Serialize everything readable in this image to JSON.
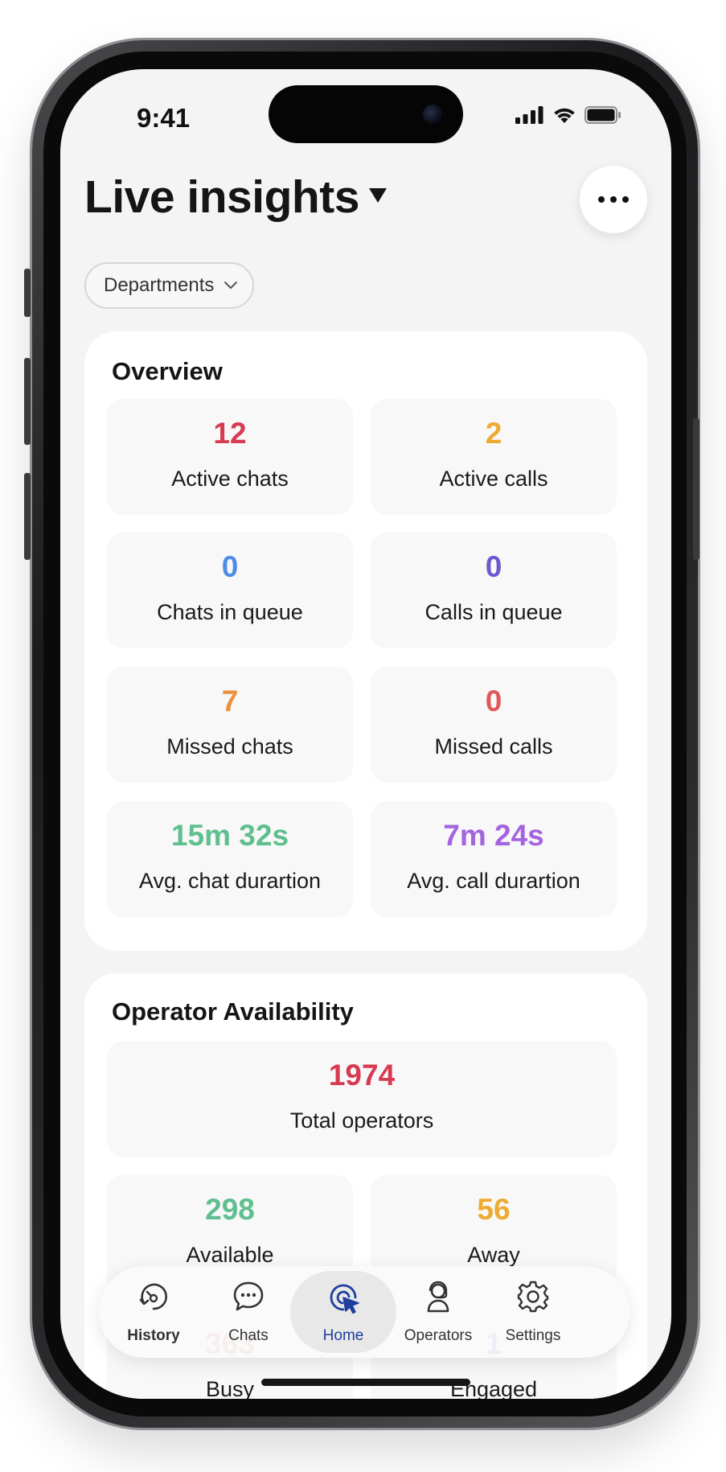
{
  "status_bar": {
    "time": "9:41"
  },
  "header": {
    "title": "Live insights",
    "filter_label": "Departments"
  },
  "overview": {
    "title": "Overview",
    "tiles": [
      {
        "value": "12",
        "label": "Active chats",
        "color": "#d63b52"
      },
      {
        "value": "2",
        "label": "Active calls",
        "color": "#eeaa33"
      },
      {
        "value": "0",
        "label": "Chats in queue",
        "color": "#4f8be8"
      },
      {
        "value": "0",
        "label": "Calls in queue",
        "color": "#6a5acd"
      },
      {
        "value": "7",
        "label": "Missed chats",
        "color": "#ee8f3a"
      },
      {
        "value": "0",
        "label": "Missed calls",
        "color": "#e05a5a"
      },
      {
        "value": "15m 32s",
        "label": "Avg. chat durartion",
        "color": "#5fbf8e"
      },
      {
        "value": "7m 24s",
        "label": "Avg. call durartion",
        "color": "#a464e0"
      }
    ]
  },
  "operator_availability": {
    "title": "Operator Availability",
    "total": {
      "value": "1974",
      "label": "Total operators",
      "color": "#d63b52"
    },
    "tiles": [
      {
        "value": "298",
        "label": "Available",
        "color": "#5fbf8e"
      },
      {
        "value": "56",
        "label": "Away",
        "color": "#eeaa33"
      },
      {
        "value": "363",
        "label": "Busy",
        "color": "#e05a5a"
      },
      {
        "value": "1",
        "label": "Engaged",
        "color": "#6a5acd"
      }
    ]
  },
  "tab_bar": {
    "items": [
      {
        "label": "History",
        "icon": "history-icon"
      },
      {
        "label": "Chats",
        "icon": "chat-bubble-icon"
      },
      {
        "label": "Home",
        "icon": "cursor-click-icon",
        "active": true
      },
      {
        "label": "Operators",
        "icon": "operator-headset-icon"
      },
      {
        "label": "Settings",
        "icon": "gear-icon"
      }
    ],
    "active_color": "#1f3f9e"
  }
}
